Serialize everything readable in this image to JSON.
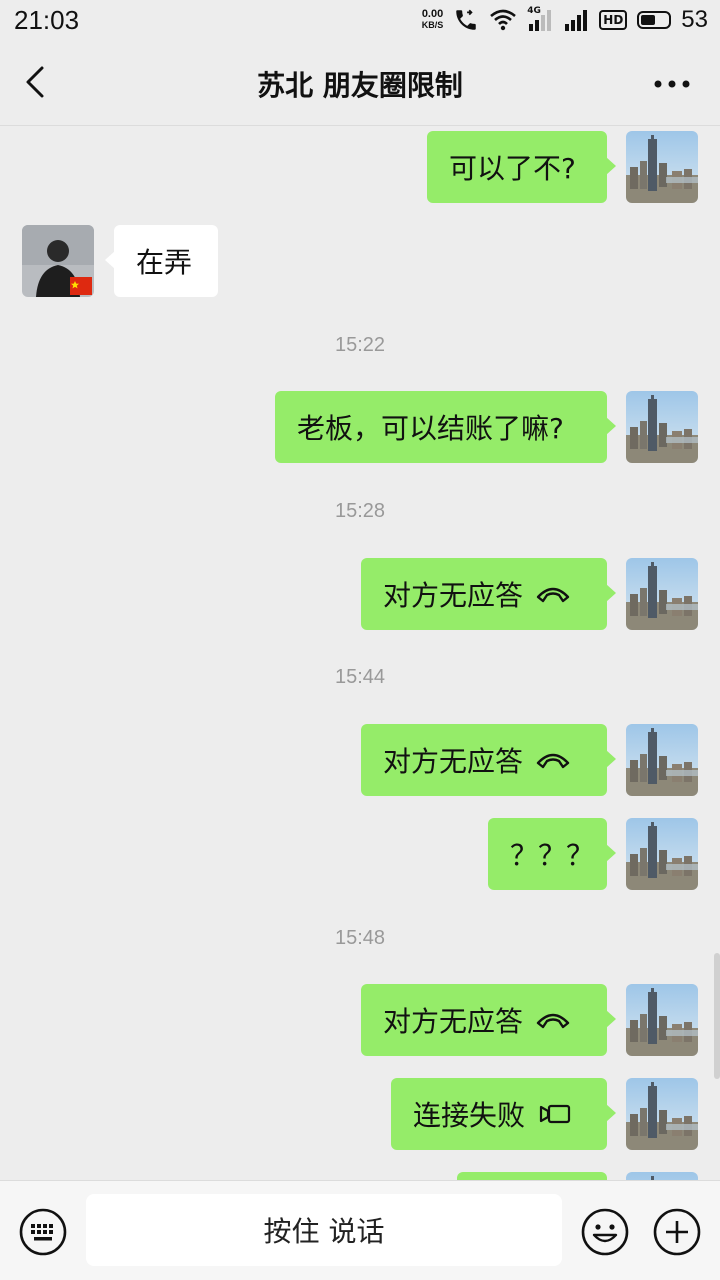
{
  "status_bar": {
    "time": "21:03",
    "net_speed_value": "0.00",
    "net_speed_unit": "KB/S",
    "network_label": "4G",
    "hd_label": "HD",
    "battery_percent": "53",
    "battery_level": 0.53
  },
  "header": {
    "title": "苏北 朋友圈限制"
  },
  "messages": [
    {
      "side": "out",
      "text": "可以了不?"
    },
    {
      "side": "in",
      "text": "在弄"
    },
    {
      "timestamp": "15:22"
    },
    {
      "side": "out",
      "text": "老板，可以结账了嘛?"
    },
    {
      "timestamp": "15:28"
    },
    {
      "side": "out",
      "text": "对方无应答",
      "icon": "phone-hangup-icon"
    },
    {
      "timestamp": "15:44"
    },
    {
      "side": "out",
      "text": "对方无应答",
      "icon": "phone-hangup-icon"
    },
    {
      "side": "out",
      "text": "？？？"
    },
    {
      "timestamp": "15:48"
    },
    {
      "side": "out",
      "text": "对方无应答",
      "icon": "phone-hangup-icon"
    },
    {
      "side": "out",
      "text": "连接失败",
      "icon": "video-call-icon"
    }
  ],
  "input_bar": {
    "hold_to_talk_label": "按住 说话"
  },
  "colors": {
    "outgoing_bubble": "#95ec69",
    "incoming_bubble": "#ffffff",
    "background": "#ededed"
  }
}
